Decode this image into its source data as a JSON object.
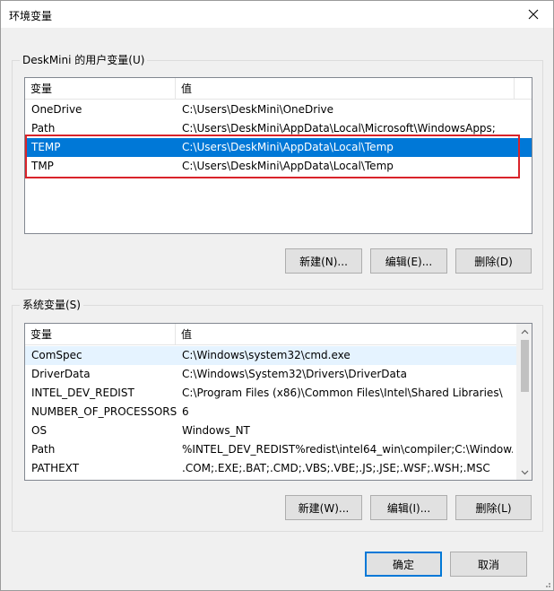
{
  "window": {
    "title": "环境变量",
    "close_icon": "close-icon"
  },
  "user_vars": {
    "group_label": "DeskMini 的用户变量(U)",
    "columns": [
      "变量",
      "值"
    ],
    "rows": [
      {
        "name": "OneDrive",
        "value": "C:\\Users\\DeskMini\\OneDrive"
      },
      {
        "name": "Path",
        "value": "C:\\Users\\DeskMini\\AppData\\Local\\Microsoft\\WindowsApps;"
      },
      {
        "name": "TEMP",
        "value": "C:\\Users\\DeskMini\\AppData\\Local\\Temp"
      },
      {
        "name": "TMP",
        "value": "C:\\Users\\DeskMini\\AppData\\Local\\Temp"
      }
    ],
    "selected_row": 2,
    "buttons": {
      "new": "新建(N)...",
      "edit": "编辑(E)...",
      "delete": "删除(D)"
    }
  },
  "system_vars": {
    "group_label": "系统变量(S)",
    "columns": [
      "变量",
      "值"
    ],
    "rows": [
      {
        "name": "ComSpec",
        "value": "C:\\Windows\\system32\\cmd.exe"
      },
      {
        "name": "DriverData",
        "value": "C:\\Windows\\System32\\Drivers\\DriverData"
      },
      {
        "name": "INTEL_DEV_REDIST",
        "value": "C:\\Program Files (x86)\\Common Files\\Intel\\Shared Libraries\\"
      },
      {
        "name": "NUMBER_OF_PROCESSORS",
        "value": "6"
      },
      {
        "name": "OS",
        "value": "Windows_NT"
      },
      {
        "name": "Path",
        "value": "%INTEL_DEV_REDIST%redist\\intel64_win\\compiler;C:\\Window..."
      },
      {
        "name": "PATHEXT",
        "value": ".COM;.EXE;.BAT;.CMD;.VBS;.VBE;.JS;.JSE;.WSF;.WSH;.MSC"
      }
    ],
    "hover_row": 0,
    "buttons": {
      "new": "新建(W)...",
      "edit": "编辑(I)...",
      "delete": "删除(L)"
    }
  },
  "footer": {
    "ok": "确定",
    "cancel": "取消"
  },
  "colors": {
    "selection": "#0078d7",
    "annotation_box": "#d9232a"
  }
}
